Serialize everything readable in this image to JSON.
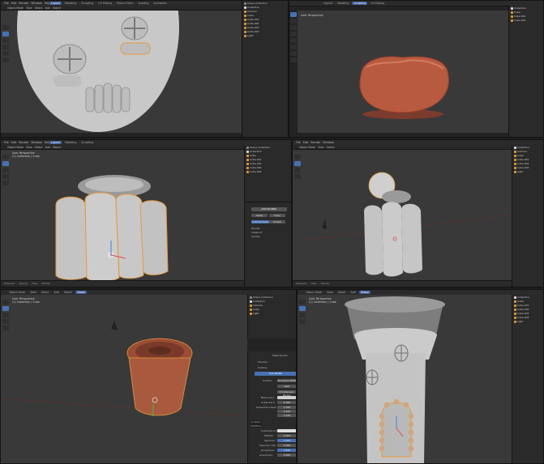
{
  "menu": [
    "File",
    "Edit",
    "Render",
    "Window",
    "Help"
  ],
  "tabs": [
    "Layout",
    "Modeling",
    "Sculpting",
    "UV Editing",
    "Texture Paint",
    "Shading",
    "Animation",
    "Rendering",
    "Compositing",
    "Scripting"
  ],
  "header_items": [
    "Object Mode",
    "View",
    "Select",
    "Add",
    "Object"
  ],
  "viewport_label": "User Perspective",
  "collection_label": "(1) Collection | Cube",
  "scene_label": "Scene",
  "view_layer_label": "View Layer",
  "outliner_items": [
    "Scene Collection",
    "Collection",
    "Camera",
    "Cube",
    "Cube.001",
    "Cube.002",
    "Cube.003",
    "Cube.004",
    "Light"
  ],
  "timeline_items": [
    "Playback",
    "Keying",
    "View",
    "Marker"
  ],
  "orientation_label": "Global",
  "properties": {
    "tab_material": "Material.001",
    "preview": "Preview",
    "surface": "Surface",
    "use_nodes": "Use Nodes",
    "surface_label": "Surface",
    "surface_value": "Principled BSDF",
    "ggx": "GGX",
    "christensen": "Christensen-Burley",
    "base_color": "Base Color",
    "subsurface": "Subsurface",
    "subsurface_value": "0.000",
    "subsurface_radius": "Subsurface Radi.",
    "radius_values": [
      "1.000",
      "0.200",
      "0.100"
    ],
    "subsurface_color": "Subsurface Col.",
    "metallic": "Metallic",
    "metallic_value": "0.000",
    "specular": "Specular",
    "specular_value": "0.500",
    "specular_tint": "Specular Tint",
    "specular_tint_value": "0.000",
    "roughness": "Roughness",
    "roughness_value": "0.500",
    "anisotropic": "Anisotropic",
    "anisotropic_value": "0.000",
    "context_tip": "Context",
    "modifiers_tip": "Modifiers"
  },
  "modifier_panel": {
    "add_modifier": "Add Modifier",
    "apply": "Apply",
    "copy": "Copy",
    "subdivision": "Subdivision",
    "catmull": "Catmull-Clark",
    "simple": "Simple",
    "render": "Render",
    "viewport": "Viewport",
    "quality": "Quality"
  },
  "colors": {
    "accent": "#4772b3",
    "viewport": "#393939",
    "clay": "#b85a3f",
    "cream_clay": "#c9c9c9",
    "terracotta": "#a95a3e",
    "selection": "#e39a3b"
  }
}
